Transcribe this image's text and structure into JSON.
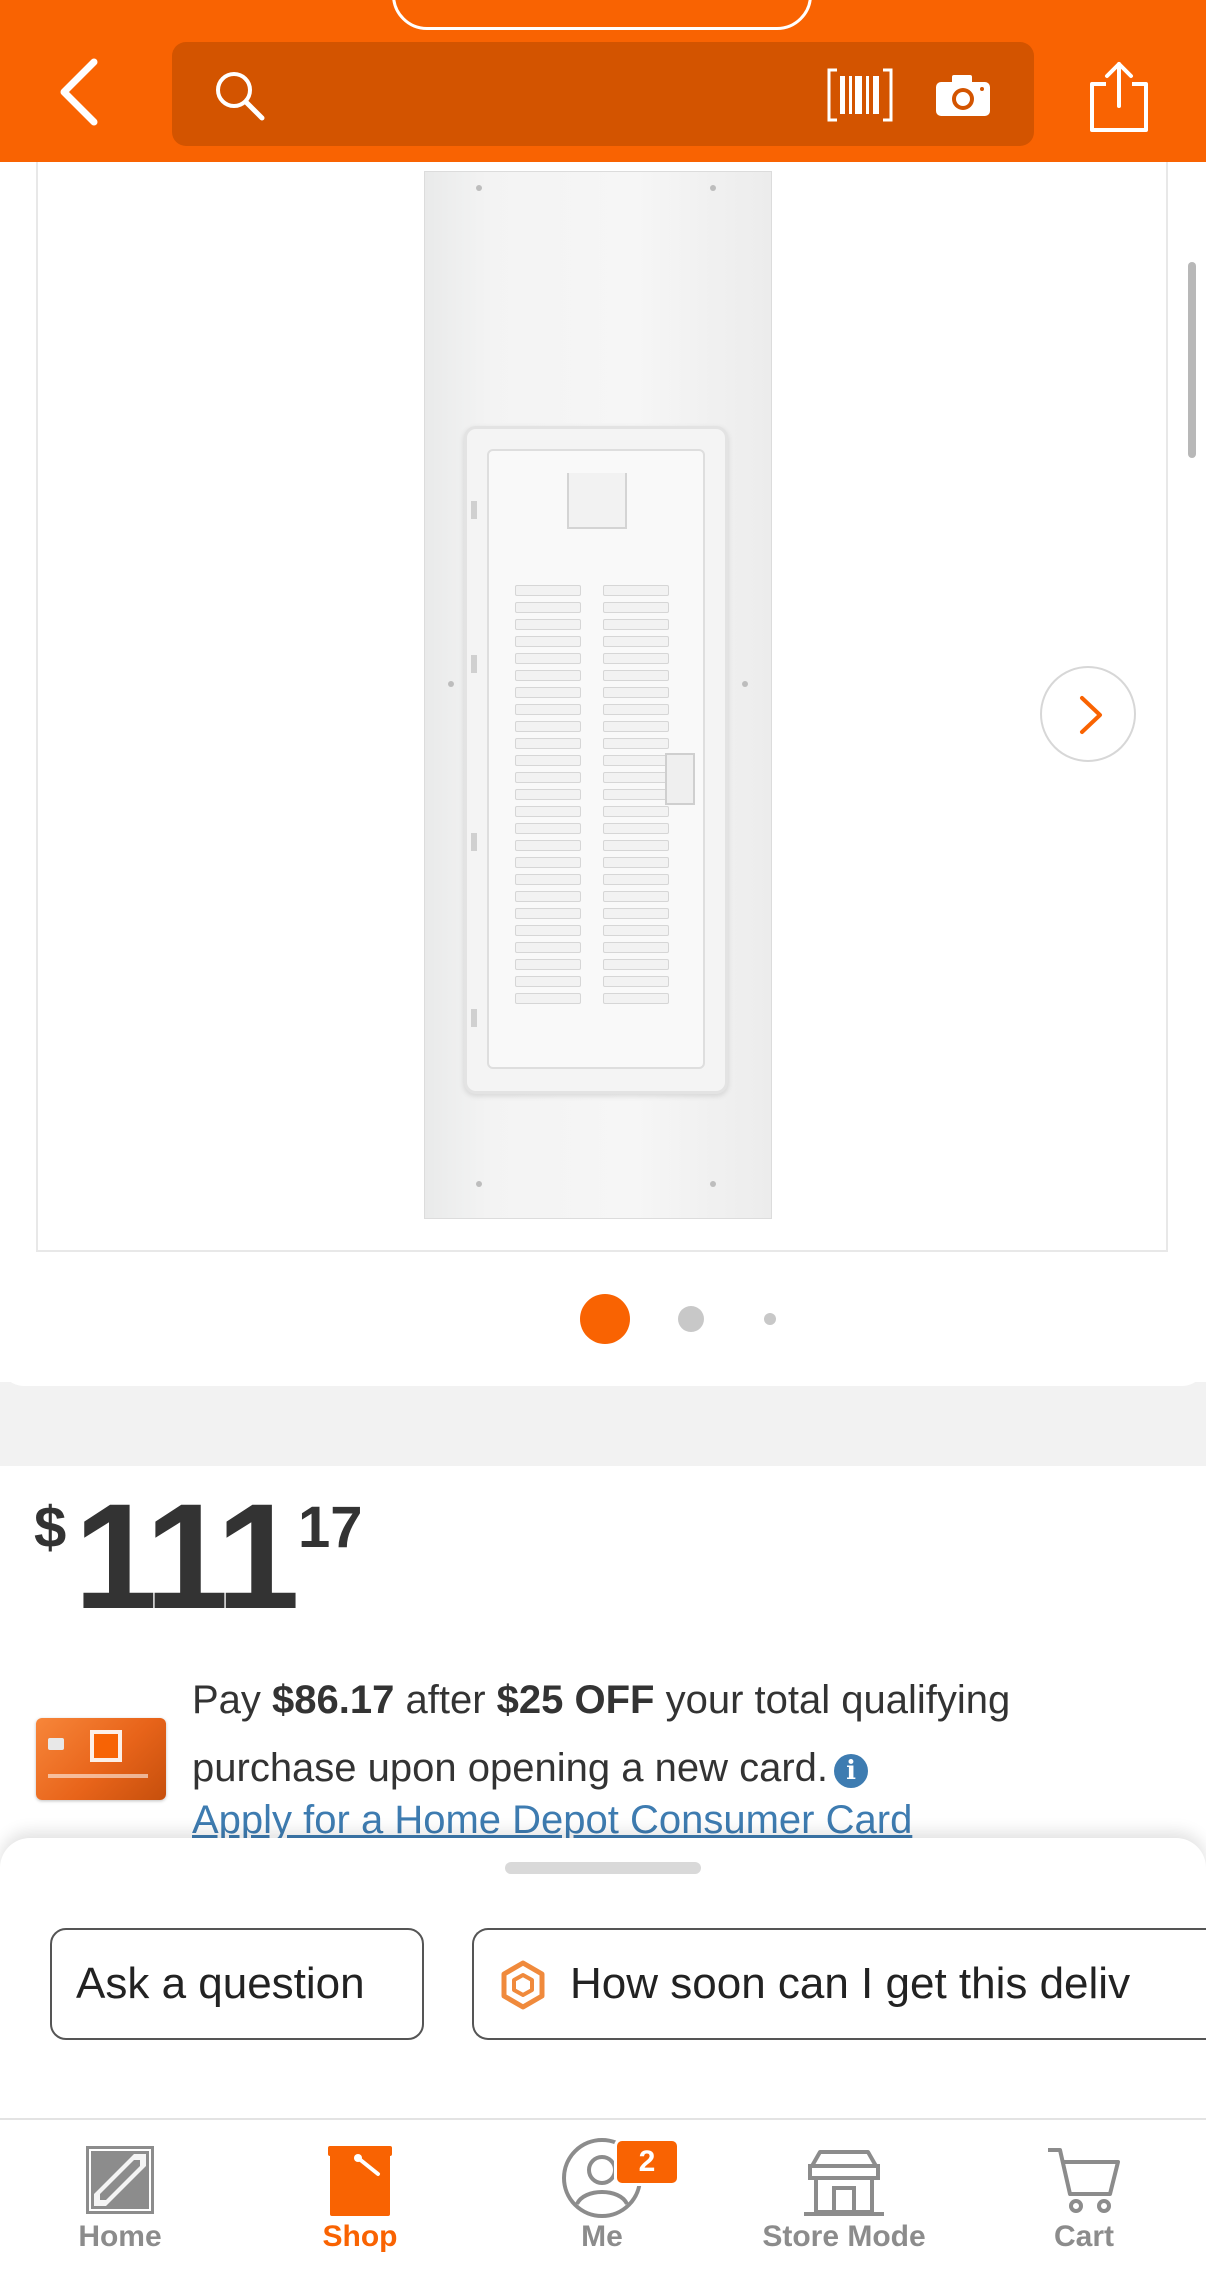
{
  "header": {
    "search_placeholder": "",
    "icons": [
      "back-icon",
      "search-icon",
      "barcode-icon",
      "camera-icon",
      "share-icon"
    ]
  },
  "gallery": {
    "image_alt": "Load center panel cover",
    "dots_total": 3,
    "active_dot": 1
  },
  "price": {
    "currency": "$",
    "dollars": "111",
    "cents": "17"
  },
  "promo": {
    "text_pay": "Pay ",
    "sale_price": "$86.17",
    "text_after": " after ",
    "discount": "$25 OFF",
    "text_rest": " your total qualifying purchase upon opening a new card.",
    "info_glyph": "i",
    "apply_link": "Apply for a Home Depot Consumer Card"
  },
  "sheet": {
    "ask_label": "Ask a question",
    "delivery_label": "How soon can I get this deliv"
  },
  "tabbar": {
    "items": [
      {
        "label": "Home"
      },
      {
        "label": "Shop"
      },
      {
        "label": "Me"
      },
      {
        "label": "Store Mode"
      },
      {
        "label": "Cart"
      }
    ],
    "active": "Shop",
    "me_badge": "2"
  },
  "colors": {
    "brand_orange": "#f96302",
    "search_bg": "#d35400",
    "link_blue": "#3e7cb1",
    "text_dark": "#333333"
  }
}
